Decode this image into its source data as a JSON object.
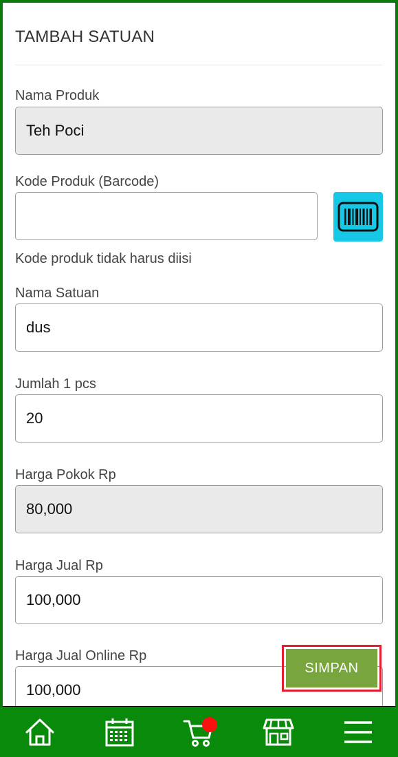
{
  "form": {
    "title": "TAMBAH SATUAN",
    "nama_produk": {
      "label": "Nama Produk",
      "value": "Teh Poci"
    },
    "kode_produk": {
      "label": "Kode Produk (Barcode)",
      "value": "",
      "help": "Kode produk tidak harus diisi"
    },
    "nama_satuan": {
      "label": "Nama Satuan",
      "value": "dus"
    },
    "jumlah": {
      "label": "Jumlah 1 pcs",
      "value": "20"
    },
    "harga_pokok": {
      "label": "Harga Pokok Rp",
      "value": "80,000"
    },
    "harga_jual": {
      "label": "Harga Jual Rp",
      "value": "100,000"
    },
    "harga_jual_online": {
      "label": "Harga Jual Online Rp",
      "value": "100,000"
    }
  },
  "actions": {
    "save_label": "SIMPAN"
  },
  "bottom_nav": {
    "items": [
      {
        "icon": "home-icon"
      },
      {
        "icon": "calendar-icon"
      },
      {
        "icon": "cart-icon",
        "badge": true
      },
      {
        "icon": "store-icon"
      },
      {
        "icon": "menu-icon"
      }
    ]
  },
  "colors": {
    "nav_bg": "#0a8a0a",
    "scan_button": "#17c7e6",
    "save_button": "#78a53e",
    "highlight_border": "#e02030",
    "badge": "#ff1010"
  }
}
